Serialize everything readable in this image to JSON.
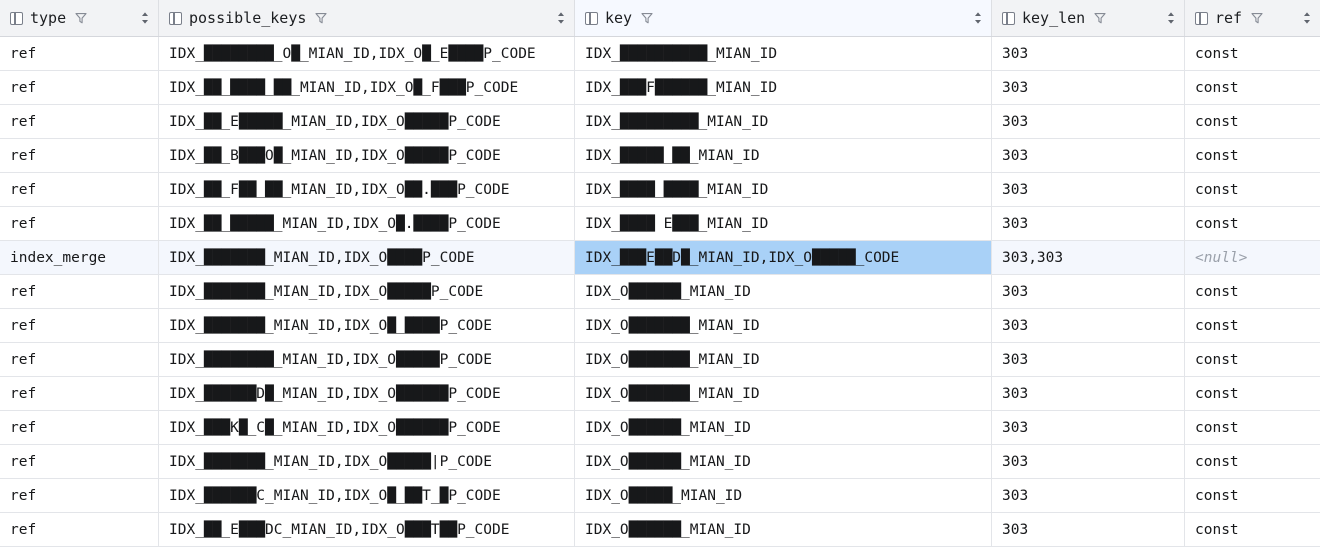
{
  "grid": {
    "columns": [
      {
        "key": "type",
        "label": "type",
        "icon": "column-icon",
        "filter_icon": "funnel-icon",
        "sort_icon": "sort-icon",
        "active": false
      },
      {
        "key": "possible_keys",
        "label": "possible_keys",
        "icon": "column-icon",
        "filter_icon": "funnel-icon",
        "sort_icon": "sort-icon",
        "active": false
      },
      {
        "key": "key",
        "label": "key",
        "icon": "column-icon",
        "filter_icon": "funnel-icon",
        "sort_icon": "sort-icon",
        "active": true
      },
      {
        "key": "key_len",
        "label": "key_len",
        "icon": "column-icon",
        "filter_icon": "funnel-icon",
        "sort_icon": "sort-icon",
        "active": false
      },
      {
        "key": "ref",
        "label": "ref",
        "icon": "column-icon",
        "filter_icon": "funnel-icon",
        "sort_icon": "sort-icon",
        "active": false
      }
    ],
    "colors": {
      "header_bg": "#f2f3f5",
      "header_active_bg": "#f6f9ff",
      "row_selected_bg": "#f4f7fd",
      "cell_selected_bg": "#a9d1f7",
      "grid_line": "#e3e5e9",
      "text": "#17181a",
      "null_text": "#9aa0aa"
    },
    "selection": {
      "row_index": 6,
      "column": "key"
    },
    "rows": [
      {
        "type": "ref",
        "possible_keys": "IDX_████████_O█_MIAN_ID,IDX_O█_E████P_CODE",
        "key": "IDX_██████████_MIAN_ID",
        "key_len": "303",
        "ref": "const"
      },
      {
        "type": "ref",
        "possible_keys": "IDX_██_████_██_MIAN_ID,IDX_O█_F███P_CODE",
        "key": "IDX_███F██████_MIAN_ID",
        "key_len": "303",
        "ref": "const"
      },
      {
        "type": "ref",
        "possible_keys": "IDX_██_E█████_MIAN_ID,IDX_O█████P_CODE",
        "key": "IDX_█████████_MIAN_ID",
        "key_len": "303",
        "ref": "const"
      },
      {
        "type": "ref",
        "possible_keys": "IDX_██_B███O█_MIAN_ID,IDX_O█████P_CODE",
        "key": "IDX_█████_██_MIAN_ID",
        "key_len": "303",
        "ref": "const"
      },
      {
        "type": "ref",
        "possible_keys": "IDX_██_F██_██_MIAN_ID,IDX_O██.███P_CODE",
        "key": "IDX_████_████_MIAN_ID",
        "key_len": "303",
        "ref": "const"
      },
      {
        "type": "ref",
        "possible_keys": "IDX_██_█████_MIAN_ID,IDX_O█.████P_CODE",
        "key": "IDX_████ E███_MIAN_ID",
        "key_len": "303",
        "ref": "const"
      },
      {
        "type": "index_merge",
        "possible_keys": "IDX_███████_MIAN_ID,IDX_O████P_CODE",
        "key": "IDX_███E██D█_MIAN_ID,IDX_O█████_CODE",
        "key_len": "303,303",
        "ref": "<null>"
      },
      {
        "type": "ref",
        "possible_keys": "IDX_███████_MIAN_ID,IDX_O█████P_CODE",
        "key": "IDX_O██████_MIAN_ID",
        "key_len": "303",
        "ref": "const"
      },
      {
        "type": "ref",
        "possible_keys": "IDX_███████_MIAN_ID,IDX_O█_████P_CODE",
        "key": "IDX_O███████_MIAN_ID",
        "key_len": "303",
        "ref": "const"
      },
      {
        "type": "ref",
        "possible_keys": "IDX_████████_MIAN_ID,IDX_O█████P_CODE",
        "key": "IDX_O███████_MIAN_ID",
        "key_len": "303",
        "ref": "const"
      },
      {
        "type": "ref",
        "possible_keys": "IDX_██████D█_MIAN_ID,IDX_O██████P_CODE",
        "key": "IDX_O███████_MIAN_ID",
        "key_len": "303",
        "ref": "const"
      },
      {
        "type": "ref",
        "possible_keys": "IDX_███K█_C█_MIAN_ID,IDX_O██████P_CODE",
        "key": "IDX_O██████_MIAN_ID",
        "key_len": "303",
        "ref": "const"
      },
      {
        "type": "ref",
        "possible_keys": "IDX_███████_MIAN_ID,IDX_O█████|P_CODE",
        "key": "IDX_O██████_MIAN_ID",
        "key_len": "303",
        "ref": "const"
      },
      {
        "type": "ref",
        "possible_keys": "IDX_██████C_MIAN_ID,IDX_O█_██T_█P_CODE",
        "key": "IDX_O█████_MIAN_ID",
        "key_len": "303",
        "ref": "const"
      },
      {
        "type": "ref",
        "possible_keys": "IDX_██_E███DC_MIAN_ID,IDX_O███T██P_CODE",
        "key": "IDX_O██████_MIAN_ID",
        "key_len": "303",
        "ref": "const"
      }
    ]
  }
}
